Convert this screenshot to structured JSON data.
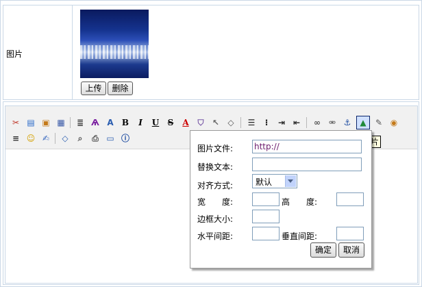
{
  "image_row": {
    "label": "图片",
    "upload_label": "上传",
    "delete_label": "删除"
  },
  "toolbar": {
    "icons": [
      "cut-icon",
      "copy-icon",
      "paste-icon",
      "paste-word-icon",
      "format-icon",
      "spellcheck-icon",
      "font-size-icon",
      "bold-icon",
      "italic-icon",
      "underline-icon",
      "strikethrough-icon",
      "font-color-icon",
      "highlight-icon",
      "select-icon",
      "eraser-icon",
      "align-left-icon",
      "bullet-list-icon",
      "indent-icon",
      "outdent-icon",
      "link-icon",
      "unlink-icon",
      "anchor-icon",
      "image-icon",
      "flash-icon",
      "media-icon",
      "horizontal-rule-icon",
      "emoticon-icon",
      "edit-icon",
      "source-icon",
      "preview-icon",
      "print-icon",
      "fullscreen-icon",
      "about-icon"
    ],
    "bold_glyph": "B",
    "italic_glyph": "I",
    "underline_glyph": "U",
    "strike_glyph": "S",
    "font_color_glyph": "A",
    "tooltip": "图片"
  },
  "image_dialog": {
    "file_label": "图片文件:",
    "file_value": "http://",
    "alt_label": "替换文本:",
    "alt_value": "",
    "align_label": "对齐方式:",
    "align_value": "默认",
    "width_label": "宽　　度:",
    "width_value": "",
    "height_label": "高　　度:",
    "height_value": "",
    "border_label": "边框大小:",
    "border_value": "",
    "hspace_label": "水平间距:",
    "hspace_value": "",
    "vspace_label": "垂直间距:",
    "vspace_value": "",
    "ok_label": "确定",
    "cancel_label": "取消"
  }
}
